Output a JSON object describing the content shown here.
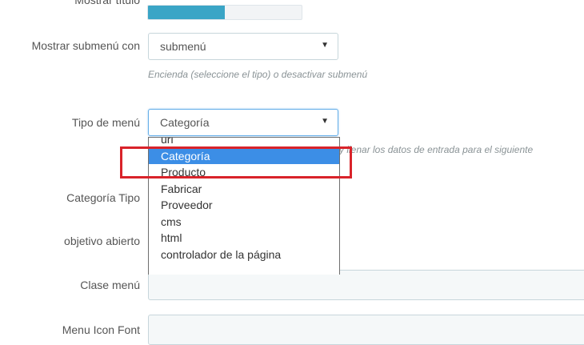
{
  "form": {
    "show_title": {
      "label": "Mostrar título"
    },
    "submenu": {
      "label": "Mostrar submenú con",
      "value": "submenú",
      "help": "Encienda (seleccione el tipo) o desactivar submenú"
    },
    "menu_type": {
      "label": "Tipo de menú",
      "value": "Categoría",
      "help_partial": "y llenar los datos de entrada para el siguiente",
      "options": [
        "url",
        "Categoría",
        "Producto",
        "Fabricar",
        "Proveedor",
        "cms",
        "html",
        "controlador de la página"
      ],
      "selected_index": 1
    },
    "category_type": {
      "label": "Categoría Tipo"
    },
    "open_target": {
      "label": "objetivo abierto"
    },
    "menu_class": {
      "label": "Clase menú",
      "value": ""
    },
    "menu_icon_font": {
      "label": "Menu Icon Font",
      "value": ""
    }
  },
  "colors": {
    "accent": "#3aa5c6",
    "selection": "#3c8ee6",
    "highlight_box": "#d9232a"
  }
}
